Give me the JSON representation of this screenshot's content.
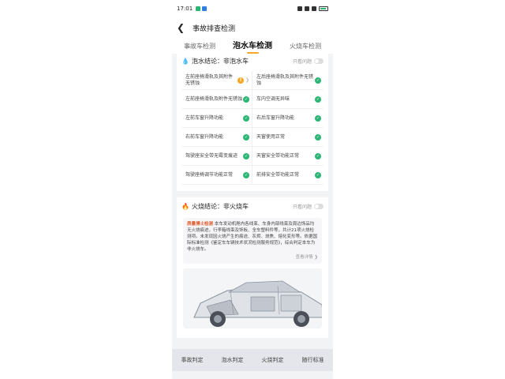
{
  "status_bar": {
    "time": "17:01"
  },
  "header": {
    "title": "事故排查检测"
  },
  "tabs": [
    {
      "label": "事故车检测",
      "active": false
    },
    {
      "label": "泡水车检测",
      "active": true
    },
    {
      "label": "火烧车检测",
      "active": false
    }
  ],
  "flood": {
    "conclusion_label": "泡水结论：",
    "conclusion_value": "非泡水车",
    "toggle_label": "只看问题",
    "items": [
      {
        "label": "左前座椅滑轨及其附件无锈蚀",
        "status": "warn"
      },
      {
        "label": "左后座椅滑轨及其附件无锈蚀",
        "status": "ok"
      },
      {
        "label": "左前座椅滑轨及附件无锈蚀",
        "status": "ok"
      },
      {
        "label": "车内空调无异味",
        "status": "ok"
      },
      {
        "label": "左前车窗升降功能",
        "status": "ok"
      },
      {
        "label": "右后车窗升降功能",
        "status": "ok"
      },
      {
        "label": "右前车窗升降功能",
        "status": "ok"
      },
      {
        "label": "天窗使用正常",
        "status": "ok"
      },
      {
        "label": "驾驶座安全带无霉变痕迹",
        "status": "ok"
      },
      {
        "label": "天窗安全带功能正常",
        "status": "ok"
      },
      {
        "label": "驾驶座椅调节功能正常",
        "status": "ok"
      },
      {
        "label": "前排安全带功能正常",
        "status": "ok"
      }
    ]
  },
  "fire": {
    "conclusion_label": "火烧结论：",
    "conclusion_value": "非火烧车",
    "toggle_label": "只看问题",
    "intro_brand": "质量博士检测",
    "intro_text": "本车发动机舱内各线束、车身内部线束及周边饰品均无火烧痕迹，行李箱线束及饰板、全车塑料件等，共计21项火烧检测项。未发现因火烧产生的痕迹、灰烬、烧焦、熔化变形等。依据国际标准检测《鉴定车车辆技术状况检测服务规范》，综合判定本车为非火烧车。",
    "more_label": "查看详情"
  },
  "bottom_nav": [
    "事故判定",
    "泡水判定",
    "火烧判定",
    "随行标准"
  ],
  "colors": {
    "accent": "#f5a623",
    "ok": "#2bb673",
    "warn": "#f5a623",
    "water": "#2f7fe0",
    "fire": "#f07a28"
  }
}
